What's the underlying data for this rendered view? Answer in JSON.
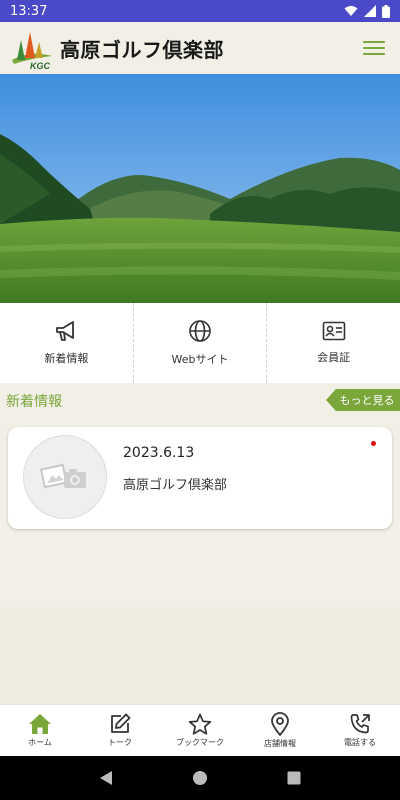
{
  "status_bar": {
    "time": "13:37"
  },
  "header": {
    "logo_caption": "KGC",
    "title": "高原ゴルフ倶楽部"
  },
  "quick_links": [
    {
      "label": "新着情報",
      "icon": "megaphone-icon"
    },
    {
      "label": "Webサイト",
      "icon": "globe-icon"
    },
    {
      "label": "会員証",
      "icon": "member-card-icon"
    }
  ],
  "news": {
    "heading": "新着情報",
    "more_label": "もっと見る",
    "items": [
      {
        "date": "2023.6.13",
        "title": "高原ゴルフ倶楽部",
        "unread": true,
        "thumb_icon": "photo-placeholder-icon"
      }
    ]
  },
  "tabs": [
    {
      "label": "ホーム",
      "icon": "home-icon",
      "active": true
    },
    {
      "label": "トーク",
      "icon": "edit-icon",
      "active": false
    },
    {
      "label": "ブックマーク",
      "icon": "star-icon",
      "active": false
    },
    {
      "label": "店舗情報",
      "icon": "map-pin-icon",
      "active": false
    },
    {
      "label": "電話する",
      "icon": "phone-icon",
      "active": false
    }
  ],
  "colors": {
    "status_bar": "#4a4ac8",
    "accent": "#7aa63c",
    "background": "#f0ebe1",
    "unread": "#e01010"
  }
}
